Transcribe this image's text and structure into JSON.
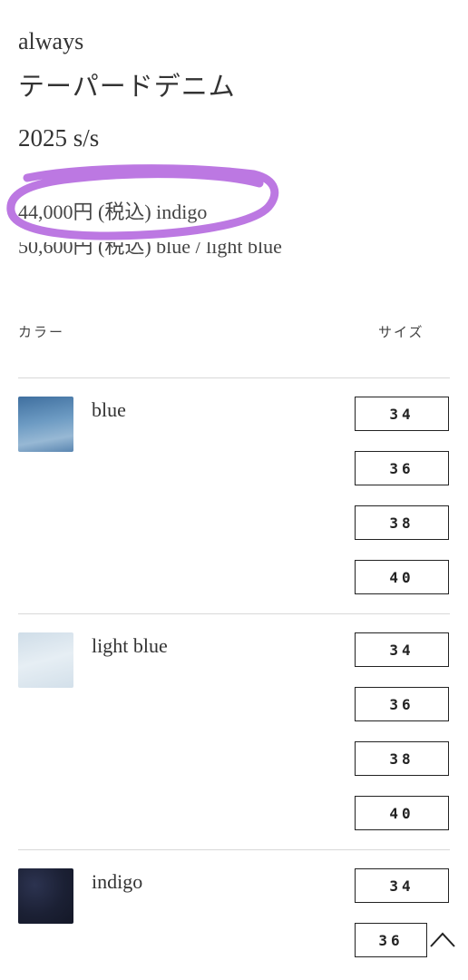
{
  "product": {
    "brand": "always",
    "name": "テーパードデニム",
    "season": "2025 s/s",
    "prices": [
      "44,000円 (税込) indigo",
      "50,600円 (税込) blue / light blue"
    ]
  },
  "table": {
    "color_header": "カラー",
    "size_header": "サイズ"
  },
  "variants": [
    {
      "color": "blue",
      "sizes": [
        "34",
        "36",
        "38",
        "40"
      ]
    },
    {
      "color": "light blue",
      "sizes": [
        "34",
        "36",
        "38",
        "40"
      ]
    },
    {
      "color": "indigo",
      "sizes": [
        "34",
        "36"
      ]
    }
  ],
  "colors": {
    "highlight": "#b66de0",
    "swatch_blue": "#4f7fae",
    "swatch_light_blue": "#dbe6ee",
    "swatch_indigo": "#1d2236"
  },
  "icons": {
    "scroll_top": "chevron-up-icon"
  }
}
